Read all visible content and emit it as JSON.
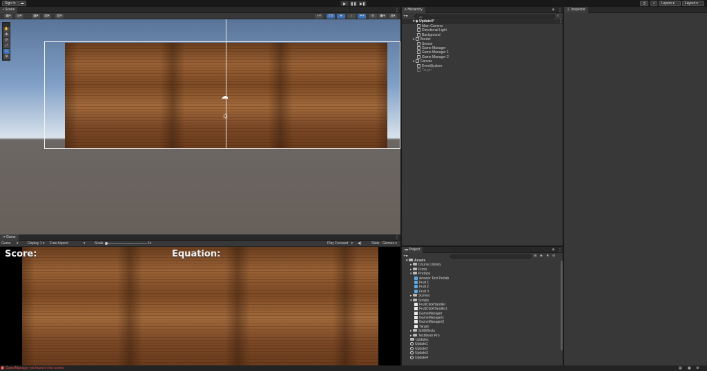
{
  "toolbar": {
    "sign_in": "Sign In",
    "cloud_icon": "cloud-icon",
    "play_icon": "▶",
    "pause_icon": "❚❚",
    "step_icon": "▶❚",
    "layers": "Layers",
    "layout": "Layout"
  },
  "scene": {
    "tab": "Scene",
    "tools": [
      "✋",
      "✥",
      "⟳",
      "⤢",
      "▭",
      "⚙"
    ]
  },
  "game": {
    "tab": "Game",
    "mode": "Game",
    "display": "Display 1",
    "aspect": "Free Aspect",
    "scale_label": "Scale",
    "scale_value": "1x",
    "play_focused": "Play Focused",
    "stats": "Stats",
    "gizmos": "Gizmos",
    "score_label": "Score:",
    "equation_label": "Equation:"
  },
  "hierarchy": {
    "tab": "Hierarchy",
    "search_placeholder": "All",
    "scene_name": "Update4*",
    "items": [
      "Main Camera",
      "Directional Light",
      "Background",
      "Border",
      "Sensor",
      "Game Manager",
      "Game Manager 1",
      "Game Manager 2",
      "Canvas",
      "EventSystem",
      "Target"
    ]
  },
  "inspector": {
    "tab": "Inspector"
  },
  "project": {
    "tab": "Project",
    "root": "Assets",
    "items": [
      {
        "label": "Course Library",
        "kind": "folder",
        "indent": 1
      },
      {
        "label": "Fonts",
        "kind": "folder",
        "indent": 1
      },
      {
        "label": "Prefabs",
        "kind": "folder",
        "indent": 1
      },
      {
        "label": "Answer Text Prefab",
        "kind": "prefab",
        "indent": 2
      },
      {
        "label": "Fruit 1",
        "kind": "prefab",
        "indent": 2
      },
      {
        "label": "Fruit 2",
        "kind": "prefab",
        "indent": 2
      },
      {
        "label": "Fruit 3",
        "kind": "prefab",
        "indent": 2
      },
      {
        "label": "Scenes",
        "kind": "folder",
        "indent": 1
      },
      {
        "label": "Scripts",
        "kind": "folder",
        "indent": 1
      },
      {
        "label": "FruitClickHandler",
        "kind": "script",
        "indent": 2
      },
      {
        "label": "FruitClickHandler1",
        "kind": "script",
        "indent": 2
      },
      {
        "label": "GameManager",
        "kind": "script",
        "indent": 2
      },
      {
        "label": "GameManager1",
        "kind": "script",
        "indent": 2
      },
      {
        "label": "GameManager2",
        "kind": "script",
        "indent": 2
      },
      {
        "label": "Target",
        "kind": "script",
        "indent": 2
      },
      {
        "label": "SoftEffects",
        "kind": "folder",
        "indent": 1
      },
      {
        "label": "TextMesh Pro",
        "kind": "folder",
        "indent": 1
      },
      {
        "label": "Updates",
        "kind": "folder",
        "indent": 1
      },
      {
        "label": "Update1",
        "kind": "scene",
        "indent": 1
      },
      {
        "label": "Update2",
        "kind": "scene",
        "indent": 1
      },
      {
        "label": "Update3",
        "kind": "scene",
        "indent": 1
      },
      {
        "label": "Update4",
        "kind": "scene",
        "indent": 1
      }
    ]
  },
  "status": {
    "message": "GameManager not found in the scene."
  }
}
